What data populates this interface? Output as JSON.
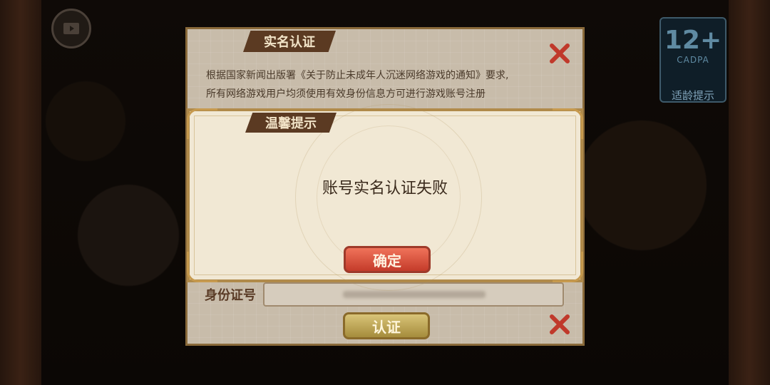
{
  "real_name_panel": {
    "title": "实名认证",
    "notice_line1": "根据国家新闻出版署《关于防止未成年人沉迷网络游戏的通知》要求,",
    "notice_line2": "所有网络游戏用户均须使用有效身份信息方可进行游戏账号注册",
    "id_label": "身份证号",
    "verify_button": "认证",
    "close_icon": "close-x-icon"
  },
  "tip_dialog": {
    "title": "温馨提示",
    "message": "账号实名认证失败",
    "confirm_button": "确定"
  },
  "age_badge": {
    "age": "12+",
    "org": "CADPA",
    "tip": "适龄提示"
  },
  "colors": {
    "confirm": "#e0553f",
    "verify": "#c9b262",
    "close": "#c0392b",
    "tab": "#5b3a22"
  }
}
